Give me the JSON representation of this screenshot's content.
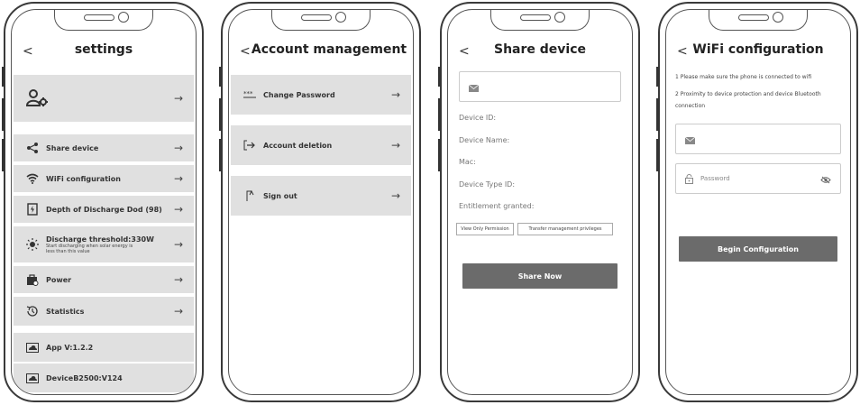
{
  "settings": {
    "title": "settings",
    "back": "<",
    "items": [
      {
        "label": "Share device",
        "icon": "share-icon"
      },
      {
        "label": "WiFi configuration",
        "icon": "wifi-icon"
      },
      {
        "label": "Depth of Discharge Dod (98)",
        "icon": "battery-icon"
      },
      {
        "label": "Discharge threshold:330W",
        "sub": "Start discharging when solar energy is less than this value",
        "icon": "sun-icon"
      },
      {
        "label": "Power",
        "icon": "power-icon"
      },
      {
        "label": "Statistics",
        "icon": "history-icon"
      }
    ],
    "app_version": "App V:1.2.2",
    "device_version": "DeviceB2500:V124",
    "arrow": "→"
  },
  "account": {
    "title": "Account management",
    "back": "<",
    "change_password": "Change Password",
    "account_deletion": "Account deletion",
    "sign_out": "Sign out",
    "arrow": "→"
  },
  "share": {
    "title": "Share device",
    "back": "<",
    "device_id": "Device ID:",
    "device_name": "Device Name:",
    "mac": "Mac:",
    "device_type_id": "Device Type ID:",
    "entitlement": "Entitlement granted:",
    "view_only": "View Only Permission",
    "transfer": "Transfer management privileges",
    "share_now": "Share Now"
  },
  "wifi": {
    "title": "WiFi configuration",
    "back": "<",
    "note1": "1 Please make sure the phone is connected to wifi",
    "note2": "2 Proximity to device protection and device Bluetooth connection",
    "password_placeholder": "Password",
    "begin": "Begin Configuration"
  }
}
